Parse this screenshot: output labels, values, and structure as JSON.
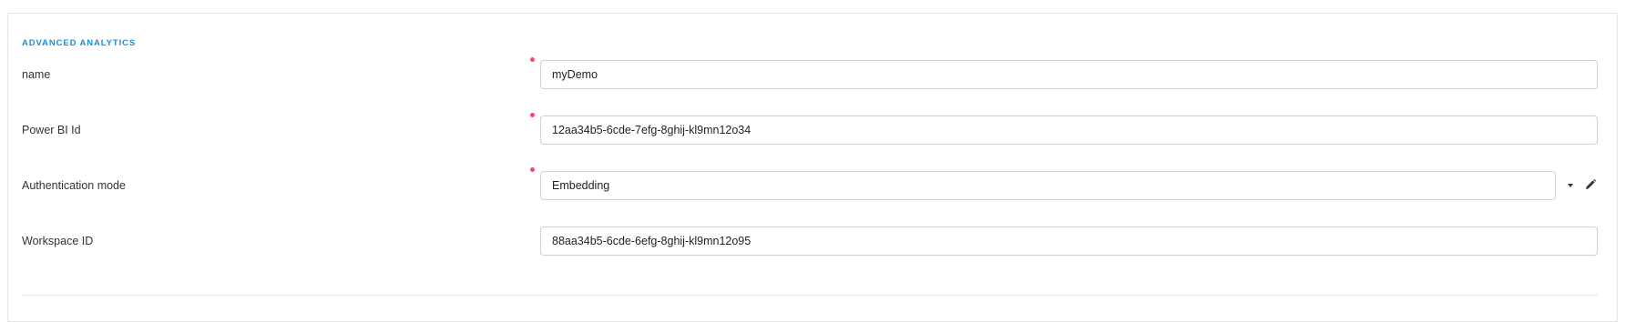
{
  "section": {
    "title": "ADVANCED ANALYTICS"
  },
  "fields": {
    "name": {
      "label": "name",
      "value": "myDemo",
      "required": true
    },
    "power_bi_id": {
      "label": "Power BI Id",
      "value": "12aa34b5-6cde-7efg-8ghij-kl9mn12o34",
      "required": true
    },
    "authentication_mode": {
      "label": "Authentication mode",
      "value": "Embedding",
      "required": true,
      "icons": [
        "chevron-down-icon",
        "pencil-icon"
      ]
    },
    "workspace_id": {
      "label": "Workspace ID",
      "value": "88aa34b5-6cde-6efg-8ghij-kl9mn12o95",
      "required": false
    }
  },
  "colors": {
    "section_title": "#1b8fd6",
    "required_dot": "#e8506a",
    "border": "#cfcfcf"
  }
}
